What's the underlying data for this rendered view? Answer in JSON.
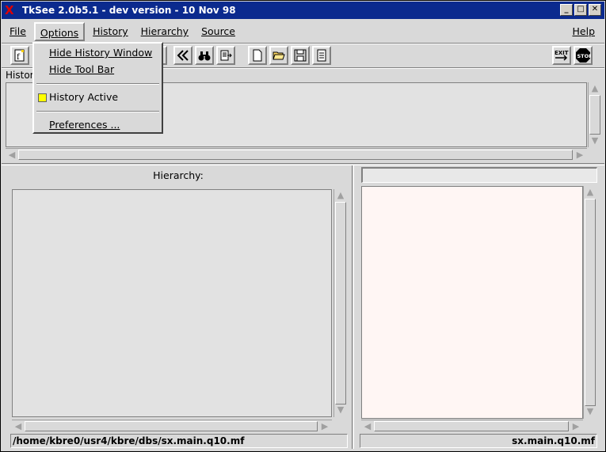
{
  "window": {
    "title": "TkSee 2.0b5.1 - dev version - 10 Nov 98",
    "logo_glyph": "X",
    "controls": {
      "minimize": "_",
      "maximize": "□",
      "close": "✕"
    }
  },
  "menubar": {
    "file": "File",
    "options": "Options",
    "history": "History",
    "hierarchy": "Hierarchy",
    "source": "Source",
    "help": "Help"
  },
  "options_menu": {
    "hide_history": "Hide History Window",
    "hide_toolbar": "Hide Tool Bar",
    "history_active": "History Active",
    "history_active_checked": true,
    "check_color": "#ffff00",
    "preferences": "Preferences ..."
  },
  "toolbar": {
    "icons": [
      "function-file-icon",
      "bar-icon",
      "rewind-icon",
      "binoculars-icon",
      "export-icon",
      "new-document-icon",
      "open-folder-icon",
      "save-disk-icon",
      "document-list-icon",
      "exit-icon",
      "stop-icon"
    ],
    "exit_label": "EXIT",
    "stop_label": "STOP"
  },
  "history": {
    "label": "Histor"
  },
  "hierarchy": {
    "title": "Hierarchy:",
    "status_path": "/home/kbre0/usr4/kbre/dbs/sx.main.q10.mf"
  },
  "source": {
    "field_value": "",
    "status_file": "sx.main.q10.mf",
    "background": "#fff6f4"
  },
  "colors": {
    "titlebar": "#0b2a8e",
    "window_bg": "#d9d9d9"
  }
}
